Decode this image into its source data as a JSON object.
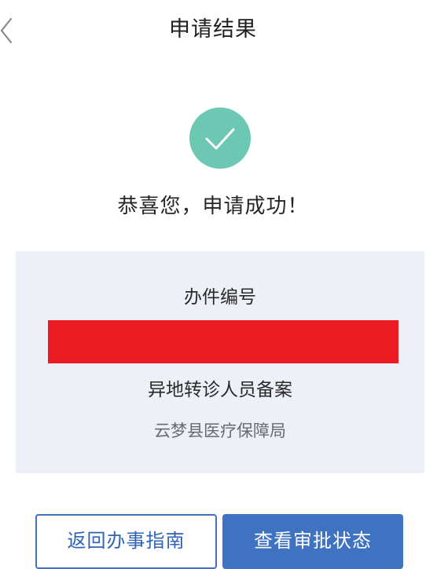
{
  "header": {
    "title": "申请结果",
    "back_icon": "chevron-left-icon"
  },
  "result": {
    "icon": "check-icon",
    "icon_color": "#6cc8b2",
    "message": "恭喜您，申请成功！"
  },
  "card": {
    "case_number_label": "办件编号",
    "case_number_redaction_color": "#ec1c24",
    "service_name": "异地转诊人员备案",
    "department": "云梦县医疗保障局"
  },
  "actions": {
    "return_guide_label": "返回办事指南",
    "check_status_label": "查看审批状态",
    "accent_color": "#3f72c0"
  }
}
